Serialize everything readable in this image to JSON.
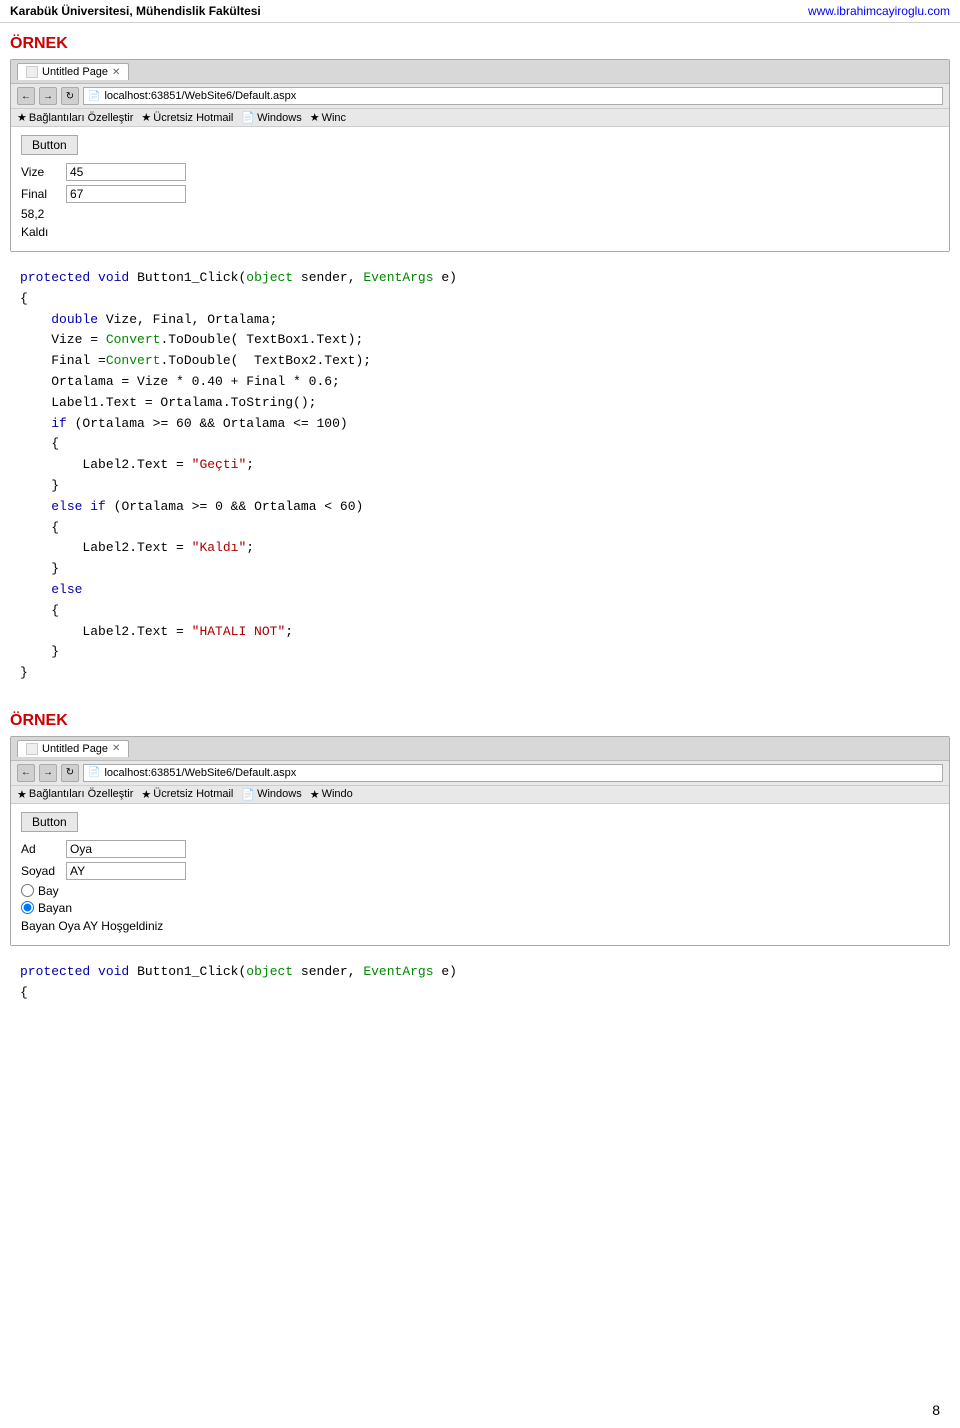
{
  "header": {
    "left": "Karabük Üniversitesi, Mühendislik Fakültesi",
    "right": "www.ibrahimcayiroglu.com"
  },
  "page_number": "8",
  "section1": {
    "ornek_label": "ÖRNEK",
    "browser": {
      "tab_title": "Untitled Page",
      "address": "localhost:63851/WebSite6/Default.aspx",
      "bookmarks": [
        "Bağlantıları Özelleştir",
        "Ücretsiz Hotmail",
        "Windows",
        "Winc"
      ],
      "button_label": "Button",
      "form_rows": [
        {
          "label": "Vize",
          "value": "45"
        },
        {
          "label": "Final",
          "value": "67"
        }
      ],
      "output_lines": [
        "58,2",
        "Kaldı"
      ]
    },
    "code": {
      "lines": [
        {
          "type": "code",
          "content": "protected void Button1_Click(object sender, EventArgs e)"
        },
        {
          "type": "code",
          "content": "{"
        },
        {
          "type": "code",
          "content": "    double Vize, Final, Ortalama;"
        },
        {
          "type": "code",
          "content": ""
        },
        {
          "type": "code",
          "content": "    Vize = Convert.ToDouble( TextBox1.Text);"
        },
        {
          "type": "code",
          "content": "    Final =Convert.ToDouble(  TextBox2.Text);"
        },
        {
          "type": "code",
          "content": ""
        },
        {
          "type": "code",
          "content": "    Ortalama = Vize * 0.40 + Final * 0.6;"
        },
        {
          "type": "code",
          "content": ""
        },
        {
          "type": "code",
          "content": "    Label1.Text = Ortalama.ToString();"
        },
        {
          "type": "code",
          "content": ""
        },
        {
          "type": "code",
          "content": "    if (Ortalama >= 60 && Ortalama <= 100)"
        },
        {
          "type": "code",
          "content": "    {"
        },
        {
          "type": "code",
          "content": "        Label2.Text = \"Geçti\";"
        },
        {
          "type": "code",
          "content": "    }"
        },
        {
          "type": "code",
          "content": "    else if (Ortalama >= 0 && Ortalama < 60)"
        },
        {
          "type": "code",
          "content": "    {"
        },
        {
          "type": "code",
          "content": "        Label2.Text = \"Kaldı\";"
        },
        {
          "type": "code",
          "content": "    }"
        },
        {
          "type": "code",
          "content": "    else"
        },
        {
          "type": "code",
          "content": "    {"
        },
        {
          "type": "code",
          "content": "        Label2.Text = \"HATALI NOT\";"
        },
        {
          "type": "code",
          "content": "    }"
        },
        {
          "type": "code",
          "content": "}"
        }
      ]
    }
  },
  "section2": {
    "ornek_label": "ÖRNEK",
    "browser": {
      "tab_title": "Untitled Page",
      "address": "localhost:63851/WebSite6/Default.aspx",
      "bookmarks": [
        "Bağlantıları Özelleştir",
        "Ücretsiz Hotmail",
        "Windows",
        "Windo"
      ],
      "button_label": "Button",
      "form_rows": [
        {
          "label": "Ad",
          "value": "Oya"
        },
        {
          "label": "Soyad",
          "value": "AY"
        }
      ],
      "radio_options": [
        {
          "label": "Bay",
          "checked": false
        },
        {
          "label": "Bayan",
          "checked": true
        }
      ],
      "output_line": "Bayan Oya AY Hoşgeldiniz"
    },
    "code_first_lines": [
      "protected void Button1_Click(object sender, EventArgs e)",
      "{"
    ]
  }
}
